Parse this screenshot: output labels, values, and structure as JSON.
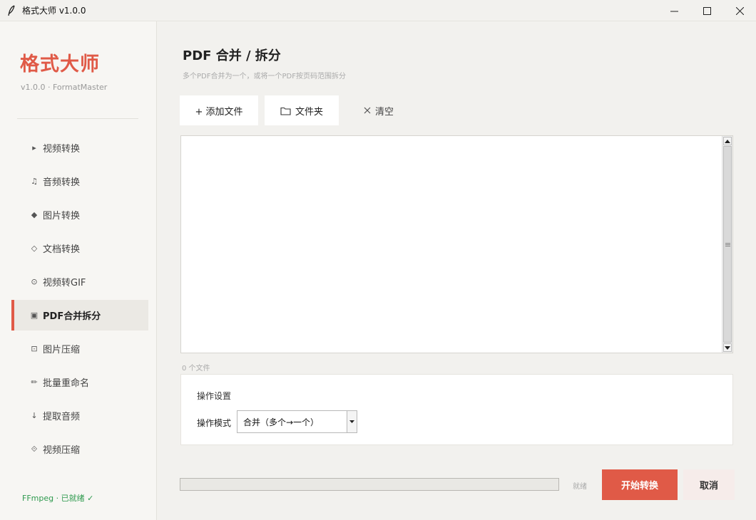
{
  "window": {
    "title": "格式大师 v1.0.0"
  },
  "sidebar": {
    "brand": "格式大师",
    "version": "v1.0.0 · FormatMaster",
    "items": [
      {
        "icon": "▸",
        "label": "视频转换"
      },
      {
        "icon": "♫",
        "label": "音频转换"
      },
      {
        "icon": "◆",
        "label": "图片转换"
      },
      {
        "icon": "◇",
        "label": "文档转换"
      },
      {
        "icon": "⊙",
        "label": "视频转GIF"
      },
      {
        "icon": "▣",
        "label": "PDF合并拆分"
      },
      {
        "icon": "⊡",
        "label": "图片压缩"
      },
      {
        "icon": "✏",
        "label": "批量重命名"
      },
      {
        "icon": "↓",
        "label": "提取音频"
      },
      {
        "icon": "⟐",
        "label": "视频压缩"
      }
    ],
    "active_index": 5,
    "ffmpeg_status": "FFmpeg · 已就绪 ✓"
  },
  "main": {
    "title": "PDF 合并 / 拆分",
    "subtitle": "多个PDF合并为一个，或将一个PDF按页码范围拆分",
    "toolbar": {
      "add_files": "+  添加文件",
      "folder": "文件夹",
      "clear": "清空"
    },
    "file_count": "0 个文件",
    "settings": {
      "title": "操作设置",
      "mode_label": "操作模式",
      "mode_value": "合并（多个→一个）"
    },
    "progress": 0,
    "status": "就绪",
    "start_button": "开始转换",
    "cancel_button": "取消"
  },
  "colors": {
    "accent": "#e05a47",
    "success": "#2e9a4e"
  }
}
